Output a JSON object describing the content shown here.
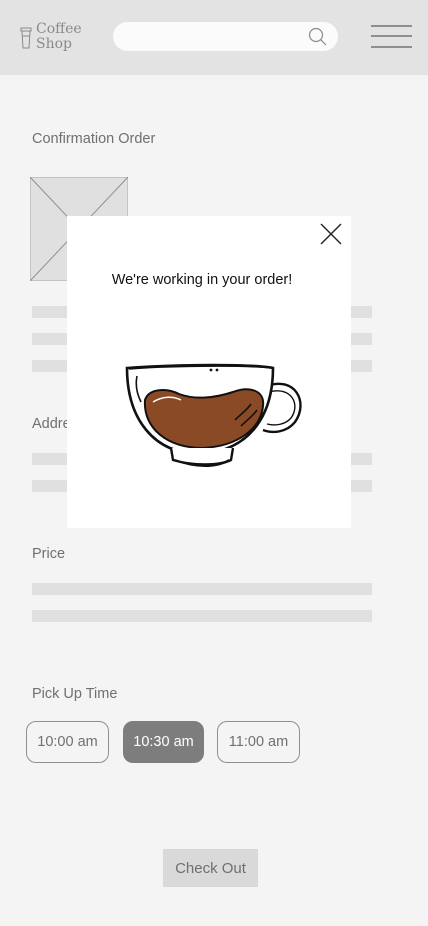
{
  "header": {
    "logo": {
      "line1": "Coffee",
      "line2": "Shop",
      "icon": "coffee-cup-icon"
    },
    "search": {
      "placeholder": "",
      "icon": "search-icon"
    },
    "menu_icon": "hamburger-menu-icon"
  },
  "order": {
    "title": "Confirmation Order",
    "image_icon": "image-placeholder-icon"
  },
  "address": {
    "label": "Address"
  },
  "price": {
    "label": "Price"
  },
  "pickup": {
    "label": "Pick Up Time",
    "times": [
      "10:00 am",
      "10:30 am",
      "11:00 am"
    ],
    "selected": "10:30 am"
  },
  "checkout": {
    "label": "Check Out"
  },
  "modal": {
    "message": "We're working in your order!",
    "close_icon": "close-icon",
    "illustration": "coffee-cup-icon"
  },
  "colors": {
    "header_bg": "#e3e3e3",
    "page_bg": "#f4f4f4",
    "placeholder": "#e0e0e0",
    "selected_time": "#7d7d7d",
    "coffee": "#8b4a26"
  }
}
